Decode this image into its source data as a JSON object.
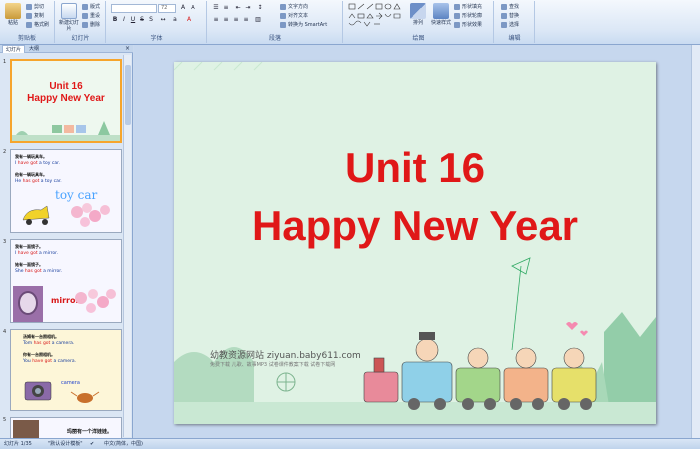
{
  "ribbon": {
    "clipboard": {
      "label": "剪贴板",
      "paste": "粘贴",
      "cut": "剪切",
      "copy": "复制",
      "format_painter": "格式刷"
    },
    "slides": {
      "label": "幻灯片",
      "new_slide": "新建幻灯片",
      "layout": "版式",
      "reset": "重设",
      "delete": "删除"
    },
    "font": {
      "label": "字体",
      "font_name": "",
      "font_size": "72"
    },
    "paragraph": {
      "label": "段落",
      "text_direction": "文字方向",
      "align_text": "对齐文本",
      "smartart": "转换为 SmartArt"
    },
    "drawing": {
      "label": "绘图",
      "arrange": "排列",
      "quick_styles": "快速样式",
      "shape_fill": "形状填充",
      "shape_outline": "形状轮廓",
      "shape_effects": "形状效果"
    },
    "editing": {
      "label": "编辑",
      "find": "查找",
      "replace": "替换",
      "select": "选择"
    }
  },
  "panel": {
    "tab_slides": "幻灯片",
    "tab_outline": "大纲",
    "close": "×",
    "thumbs": [
      {
        "num": "1",
        "title1": "Unit 16",
        "title2": "Happy New Year"
      },
      {
        "num": "2",
        "cn1": "我有一辆玩具车。",
        "en1a": "I ",
        "en1b": "have got",
        "en1c": " a toy car.",
        "cn2": "他有一辆玩具车。",
        "en2a": "He ",
        "en2b": "has got",
        "en2c": " a toy car.",
        "word": "toy car"
      },
      {
        "num": "3",
        "cn1": "我有一面镜子。",
        "en1a": "I ",
        "en1b": "have got",
        "en1c": " a mirror.",
        "cn2": "她有一面镜子。",
        "en2a": "She ",
        "en2b": "has got",
        "en2c": " a mirror.",
        "word": "mirror"
      },
      {
        "num": "4",
        "cn1": "汤姆有一台照相机。",
        "en1a": "Tom ",
        "en1b": "has got",
        "en1c": " a camera.",
        "cn2": "你有一台照相机。",
        "en2a": "You ",
        "en2b": "have got",
        "en2c": " a camera.",
        "word": "camera"
      },
      {
        "num": "5",
        "cn1": "玛丽有一个洋娃娃。"
      }
    ]
  },
  "slide": {
    "title_line1": "Unit 16",
    "title_line2": "Happy New Year",
    "site_cn": "幼教资源网站 ziyuan.baby611.com",
    "site_sub": "免费下载 儿歌、故事MP3 试卷课件教案下载 试卷下载网"
  },
  "status": {
    "slide_no": "幻灯片 1/35",
    "theme": "\"默认设计模板\"",
    "language": "中文(简体，中国)"
  },
  "colors": {
    "title_red": "#e01818",
    "slide_bg": "#dff2e4",
    "selected_border": "#f6a52c"
  }
}
